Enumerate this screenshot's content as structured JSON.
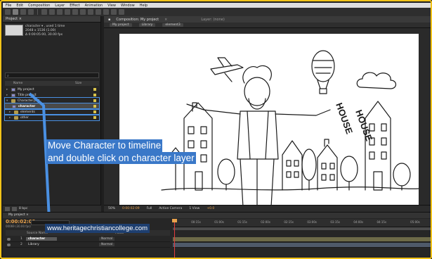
{
  "menu": [
    "File",
    "Edit",
    "Composition",
    "Layer",
    "Effect",
    "Animation",
    "View",
    "Window",
    "Help"
  ],
  "project_panel": {
    "tab": "Project ×",
    "info_lines": [
      "character ▾ , used 1 time",
      "2048 x 1536 (1.00)",
      "Δ 0:00:05:00, 30.00 fps"
    ],
    "search_placeholder": "",
    "columns": [
      "Name",
      "Size"
    ],
    "rows": [
      {
        "label": "My project",
        "kind": "comp"
      },
      {
        "label": "Title project",
        "kind": "comp"
      },
      {
        "label": "Character.psd",
        "kind": "folder"
      },
      {
        "label": "character",
        "kind": "comp"
      },
      {
        "label": "elements",
        "kind": "folder"
      },
      {
        "label": "other",
        "kind": "folder"
      }
    ],
    "footer_label": "8 bpc"
  },
  "comp_panel": {
    "tab": "Composition: My project",
    "breadcrumbs": [
      "My project",
      "Library",
      "element3"
    ],
    "layer_tab": "Layer: (none)",
    "footer": {
      "zoom": "50%",
      "timecode": "0:00:02:09",
      "resolution": "Full",
      "camera": "Active Camera",
      "views": "1 View",
      "offset": "+0.0"
    }
  },
  "instruction": {
    "line1": "Move Character to timeline",
    "line2": "and double click on character layer"
  },
  "timeline": {
    "tab": "My project ×",
    "time": "0:00:02:09",
    "frames": "00069 (30.00 fps)",
    "columns": {
      "source": "Source Name",
      "mode": "Mode"
    },
    "layers": [
      {
        "num": "1",
        "name": "character",
        "mode": "Normal",
        "selected": true
      },
      {
        "num": "2",
        "name": "Library",
        "mode": "Normal",
        "selected": false
      }
    ],
    "ruler": [
      "00:15s",
      "01:00s",
      "01:15s",
      "02:00s",
      "02:15s",
      "03:00s",
      "03:15s",
      "04:00s",
      "04:15s",
      "05:00s"
    ]
  },
  "watermark": "www.heritagechristiancollege.com",
  "colors": {
    "frame_border": "#f2c318",
    "instruction_bg": "#3a78c8",
    "timecode": "#e9a24c",
    "arrow": "#4a90e2"
  }
}
